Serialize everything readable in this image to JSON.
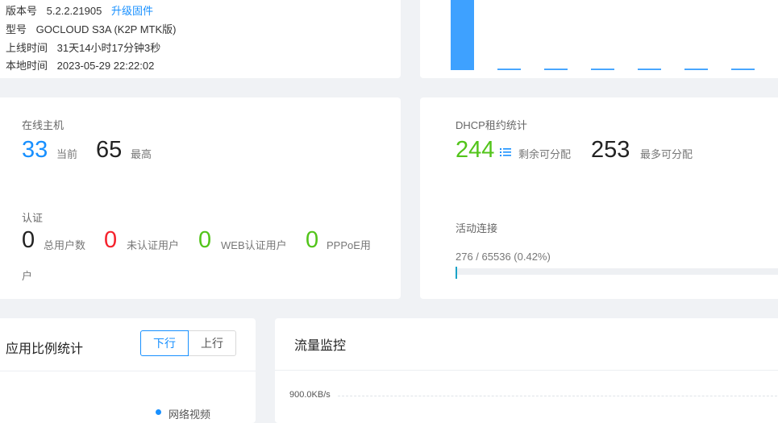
{
  "system": {
    "version_label": "版本号",
    "version_value": "5.2.2.21905",
    "upgrade_link": "升级固件",
    "model_label": "型号",
    "model_value": "GOCLOUD S3A (K2P MTK版)",
    "uptime_label": "上线时间",
    "uptime_value": "31天14小时17分钟3秒",
    "localtime_label": "本地时间",
    "localtime_value": "2023-05-29 22:22:02"
  },
  "top_chart": {
    "chart_data": {
      "type": "bar",
      "values": [
        1.0,
        0.02,
        0.02,
        0.02,
        0.02,
        0.02,
        0.02
      ],
      "color": "#3ea1ff"
    }
  },
  "hosts": {
    "title": "在线主机",
    "current_value": "33",
    "current_label": "当前",
    "max_value": "65",
    "max_label": "最高"
  },
  "auth": {
    "title": "认证",
    "total_value": "0",
    "total_label": "总用户数",
    "unauth_value": "0",
    "unauth_label": "未认证用户",
    "web_value": "0",
    "web_label": "WEB认证用户",
    "pppoe_value": "0",
    "pppoe_label_line1": "PPPoE用",
    "pppoe_label_line2": "户"
  },
  "dhcp": {
    "title": "DHCP租约统计",
    "remaining_value": "244",
    "remaining_label": "剩余可分配",
    "list_icon": "list-icon",
    "max_value": "253",
    "max_label": "最多可分配"
  },
  "connections": {
    "title": "活动连接",
    "stats": "276 / 65536 (0.42%)",
    "fraction": 0.0042
  },
  "app_ratio": {
    "title": "应用比例统计",
    "down_label": "下行",
    "up_label": "上行",
    "legend_item": "网络视频"
  },
  "traffic": {
    "title": "流量监控",
    "y_tick": "900.0KB/s"
  },
  "colors": {
    "blue": "#1890ff",
    "green": "#52c41a",
    "red": "#f5222d",
    "bar": "#3ea1ff"
  }
}
